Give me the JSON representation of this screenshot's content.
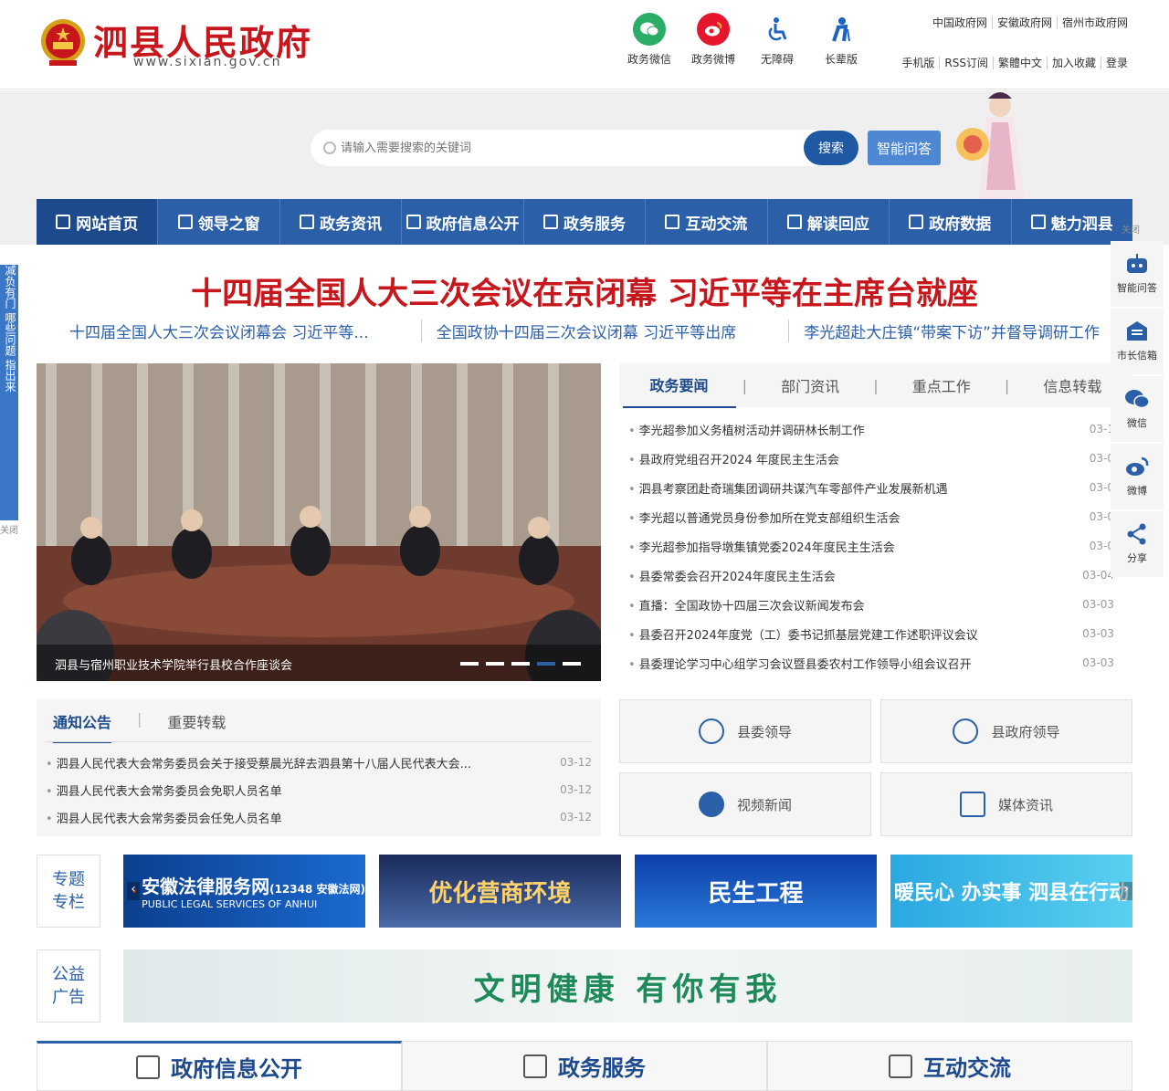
{
  "header": {
    "site_title": "泗县人民政府",
    "site_domain": "www.sixian.gov.cn",
    "quick_links": [
      {
        "label": "政务微信",
        "icon": "wechat-icon",
        "color": "#2aae67"
      },
      {
        "label": "政务微博",
        "icon": "weibo-icon",
        "color": "#e6162d"
      },
      {
        "label": "无障碍",
        "icon": "accessibility-icon",
        "color": "#1d63c4"
      },
      {
        "label": "长辈版",
        "icon": "elder-icon",
        "color": "#1d63c4"
      }
    ],
    "top_links": [
      "中国政府网",
      "安徽政府网",
      "宿州市政府网"
    ],
    "util_links": [
      "手机版",
      "RSS订阅",
      "繁體中文",
      "加入收藏",
      "登录"
    ]
  },
  "search": {
    "placeholder": "请输入需要搜索的关键词",
    "button": "搜索",
    "ai_button": "智能问答"
  },
  "nav": {
    "items": [
      "网站首页",
      "领导之窗",
      "政务资讯",
      "政府信息公开",
      "政务服务",
      "互动交流",
      "解读回应",
      "政府数据",
      "魅力泗县"
    ],
    "close": "关闭"
  },
  "headline": {
    "title": "十四届全国人大三次会议在京闭幕 习近平等在主席台就座",
    "subs": [
      "十四届全国人大三次会议闭幕会 习近平等...",
      "全国政协十四届三次会议闭幕 习近平等出席",
      "李光超赴大庄镇“带案下访”并督导调研工作"
    ]
  },
  "carousel": {
    "caption": "泗县与宿州职业技术学院举行县校合作座谈会",
    "active_index": 3,
    "count": 5
  },
  "news": {
    "tabs": [
      "政务要闻",
      "部门资讯",
      "重点工作",
      "信息转载"
    ],
    "items": [
      {
        "title": "李光超参加义务植树活动并调研林长制工作",
        "date": "03-1"
      },
      {
        "title": "县政府党组召开2024 年度民主生活会",
        "date": "03-0"
      },
      {
        "title": "泗县考察团赴奇瑞集团调研共谋汽车零部件产业发展新机遇",
        "date": "03-0"
      },
      {
        "title": "李光超以普通党员身份参加所在党支部组织生活会",
        "date": "03-0"
      },
      {
        "title": "李光超参加指导墩集镇党委2024年度民主生活会",
        "date": "03-0"
      },
      {
        "title": "县委常委会召开2024年度民主生活会",
        "date": "03-04"
      },
      {
        "title": "直播：全国政协十四届三次会议新闻发布会",
        "date": "03-03"
      },
      {
        "title": "县委召开2024年度党（工）委书记抓基层党建工作述职评议会议",
        "date": "03-03"
      },
      {
        "title": "县委理论学习中心组学习会议暨县委农村工作领导小组会议召开",
        "date": "03-03"
      }
    ]
  },
  "notice": {
    "tabs": [
      "通知公告",
      "重要转载"
    ],
    "items": [
      {
        "title": "泗县人民代表大会常务委员会关于接受蔡晨光辞去泗县第十八届人民代表大会...",
        "date": "03-12"
      },
      {
        "title": "泗县人民代表大会常务委员会免职人员名单",
        "date": "03-12"
      },
      {
        "title": "泗县人民代表大会常务委员会任免人员名单",
        "date": "03-12"
      }
    ]
  },
  "cards": [
    "县委领导",
    "县政府领导",
    "视频新闻",
    "媒体资讯"
  ],
  "special": {
    "label": "专题专栏",
    "banners": [
      {
        "text": "安徽法律服务网",
        "sub": "(12348 安徽法网)",
        "en": "PUBLIC LEGAL SERVICES OF ANHUI"
      },
      {
        "text": "优化营商环境"
      },
      {
        "text": "民生工程"
      },
      {
        "text": "暖民心 办实事 泗县在行动"
      }
    ]
  },
  "ad": {
    "label": "公益广告",
    "text": "文明健康 有你有我"
  },
  "bottom_tabs": [
    "政府信息公开",
    "政务服务",
    "互动交流"
  ],
  "float_right": [
    {
      "label": "智能问答",
      "icon": "robot-icon"
    },
    {
      "label": "市长信箱",
      "icon": "mailbox-icon"
    },
    {
      "label": "微信",
      "icon": "wechat-icon"
    },
    {
      "label": "微博",
      "icon": "weibo-icon"
    },
    {
      "label": "分享",
      "icon": "share-icon"
    }
  ],
  "float_left": {
    "text": "减负有门 哪些问题 指出来",
    "close": "关闭"
  }
}
